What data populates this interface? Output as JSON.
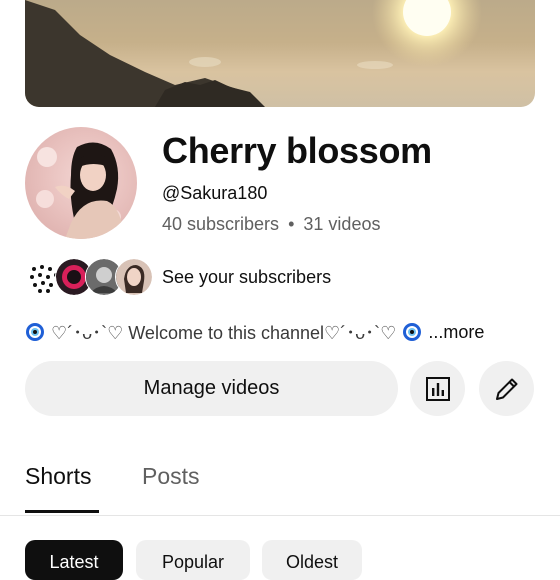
{
  "channel": {
    "name": "Cherry blossom",
    "handle": "@Sakura180",
    "subscribers": "40 subscribers",
    "separator": "•",
    "videos": "31 videos"
  },
  "subscribers_link": "See your subscribers",
  "description": {
    "text": "♡´･ᴗ･`♡ Welcome to this channel♡´･ᴗ･`♡",
    "more": "...more",
    "emoji_icon": "nazar-amulet-icon"
  },
  "actions": {
    "manage_label": "Manage videos",
    "analytics_icon": "analytics-icon",
    "edit_icon": "edit-pencil-icon"
  },
  "tabs": [
    {
      "label": "Shorts",
      "active": true
    },
    {
      "label": "Posts",
      "active": false
    }
  ],
  "chips": [
    {
      "label": "Latest",
      "active": true
    },
    {
      "label": "Popular",
      "active": false
    },
    {
      "label": "Oldest",
      "active": false
    }
  ],
  "colors": {
    "text_primary": "#0f0f0f",
    "text_secondary": "#606060",
    "button_bg": "#f0f0f0",
    "chip_active_bg": "#0f0f0f"
  }
}
